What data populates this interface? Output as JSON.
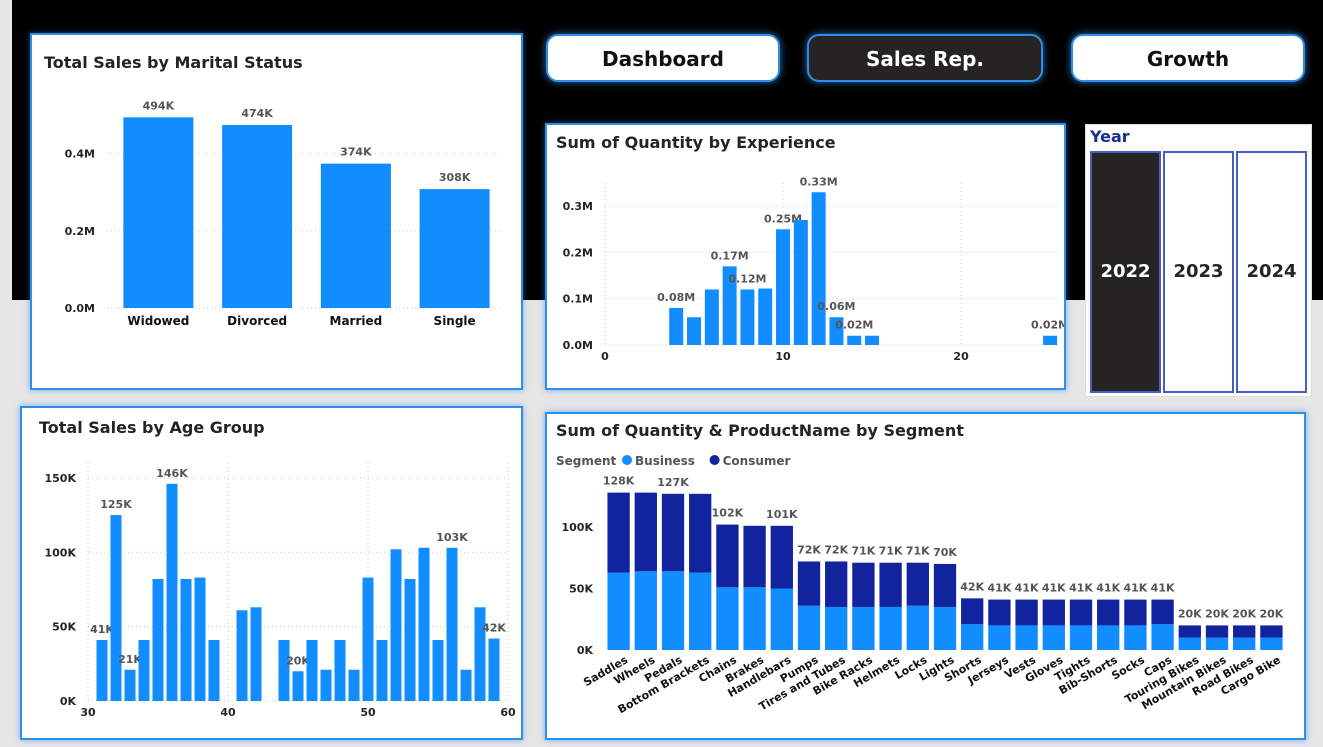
{
  "nav": {
    "buttons": [
      {
        "label": "Dashboard",
        "active": false
      },
      {
        "label": "Sales Rep.",
        "active": true
      },
      {
        "label": "Growth",
        "active": false
      }
    ]
  },
  "year_slicer": {
    "title": "Year",
    "options": [
      "2022",
      "2023",
      "2024"
    ],
    "selected": "2022"
  },
  "colors": {
    "primary": "#118dff",
    "consumer": "#12239e",
    "selected": "#252423",
    "border": "#2d8fe6"
  },
  "chart_data": [
    {
      "id": "marital",
      "type": "bar",
      "title": "Total Sales by Marital Status",
      "categories": [
        "Widowed",
        "Divorced",
        "Married",
        "Single"
      ],
      "values": [
        494000,
        474000,
        374000,
        308000
      ],
      "data_labels": [
        "494K",
        "474K",
        "374K",
        "308K"
      ],
      "ylim": [
        0,
        500000
      ],
      "yticks": [
        0,
        200000,
        400000
      ],
      "ytick_labels": [
        "0.0M",
        "0.2M",
        "0.4M"
      ],
      "grid": true
    },
    {
      "id": "experience",
      "type": "bar",
      "title": "Sum of Quantity by Experience",
      "x": [
        4,
        5,
        6,
        7,
        8,
        9,
        10,
        11,
        12,
        13,
        14,
        15,
        25
      ],
      "values": [
        80000,
        60000,
        120000,
        170000,
        120000,
        122000,
        250000,
        270000,
        330000,
        60000,
        20000,
        20000,
        20000
      ],
      "data_labels": [
        {
          "index": 0,
          "text": "0.08M"
        },
        {
          "index": 3,
          "text": "0.17M"
        },
        {
          "index": 4,
          "text": "0.12M"
        },
        {
          "index": 6,
          "text": "0.25M"
        },
        {
          "index": 8,
          "text": "0.33M"
        },
        {
          "index": 9,
          "text": "0.06M"
        },
        {
          "index": 10,
          "text": "0.02M"
        },
        {
          "index": 12,
          "text": "0.02M"
        }
      ],
      "xlim": [
        0,
        25.5
      ],
      "xticks": [
        0,
        10,
        20
      ],
      "xtick_labels": [
        "0",
        "10",
        "20"
      ],
      "ylim": [
        0,
        350000
      ],
      "yticks": [
        0,
        100000,
        200000,
        300000
      ],
      "ytick_labels": [
        "0.0M",
        "0.1M",
        "0.2M",
        "0.3M"
      ],
      "grid": true
    },
    {
      "id": "age",
      "type": "bar",
      "title": "Total Sales by Age Group",
      "x": [
        31,
        32,
        33,
        34,
        35,
        36,
        37,
        38,
        39,
        41,
        42,
        44,
        45,
        46,
        47,
        48,
        49,
        50,
        51,
        52,
        53,
        54,
        55,
        56,
        57,
        58,
        59
      ],
      "values": [
        41000,
        125000,
        21000,
        41000,
        82000,
        146000,
        82000,
        83000,
        41000,
        61000,
        63000,
        41000,
        20000,
        41000,
        21000,
        41000,
        21000,
        83000,
        41000,
        102000,
        82000,
        103000,
        41000,
        103000,
        21000,
        63000,
        42000
      ],
      "data_labels": [
        {
          "index": 0,
          "text": "41K"
        },
        {
          "index": 1,
          "text": "125K"
        },
        {
          "index": 2,
          "text": "21K"
        },
        {
          "index": 5,
          "text": "146K"
        },
        {
          "index": 12,
          "text": "20K"
        },
        {
          "index": 23,
          "text": "103K"
        },
        {
          "index": 26,
          "text": "42K"
        }
      ],
      "xlim": [
        30,
        60
      ],
      "xticks": [
        30,
        40,
        50,
        60
      ],
      "xtick_labels": [
        "30",
        "40",
        "50",
        "60"
      ],
      "ylim": [
        0,
        160000
      ],
      "yticks": [
        0,
        50000,
        100000,
        150000
      ],
      "ytick_labels": [
        "0K",
        "50K",
        "100K",
        "150K"
      ],
      "grid": true
    },
    {
      "id": "segment",
      "type": "bar",
      "stacked": true,
      "title": "Sum of Quantity & ProductName by Segment",
      "legend_title": "Segment",
      "categories": [
        "Saddles",
        "Wheels",
        "Pedals",
        "Bottom Brackets",
        "Chains",
        "Brakes",
        "Handlebars",
        "Pumps",
        "Tires and Tubes",
        "Bike Racks",
        "Helmets",
        "Locks",
        "Lights",
        "Shorts",
        "Jerseys",
        "Vests",
        "Gloves",
        "Tights",
        "Bib-Shorts",
        "Socks",
        "Caps",
        "Touring Bikes",
        "Mountain Bikes",
        "Road Bikes",
        "Cargo Bike"
      ],
      "series": [
        {
          "name": "Business",
          "values": [
            63000,
            64000,
            64000,
            63000,
            51000,
            51000,
            50000,
            36000,
            35000,
            35000,
            35000,
            36000,
            35000,
            21000,
            20000,
            20000,
            20000,
            20000,
            20000,
            20000,
            21000,
            10000,
            10000,
            10000,
            10000
          ]
        },
        {
          "name": "Consumer",
          "values": [
            65000,
            64000,
            63000,
            64000,
            51000,
            50000,
            51000,
            36000,
            37000,
            36000,
            36000,
            35000,
            35000,
            21000,
            21000,
            21000,
            21000,
            21000,
            21000,
            21000,
            20000,
            10000,
            10000,
            10000,
            10000
          ]
        }
      ],
      "total_labels": [
        "128K",
        "",
        "127K",
        "",
        "102K",
        "",
        "101K",
        "72K",
        "72K",
        "71K",
        "71K",
        "71K",
        "70K",
        "42K",
        "41K",
        "41K",
        "41K",
        "41K",
        "41K",
        "41K",
        "41K",
        "20K",
        "20K",
        "20K",
        "20K"
      ],
      "ylim": [
        0,
        135000
      ],
      "yticks": [
        0,
        50000,
        100000
      ],
      "ytick_labels": [
        "0K",
        "50K",
        "100K"
      ],
      "grid": false
    }
  ]
}
